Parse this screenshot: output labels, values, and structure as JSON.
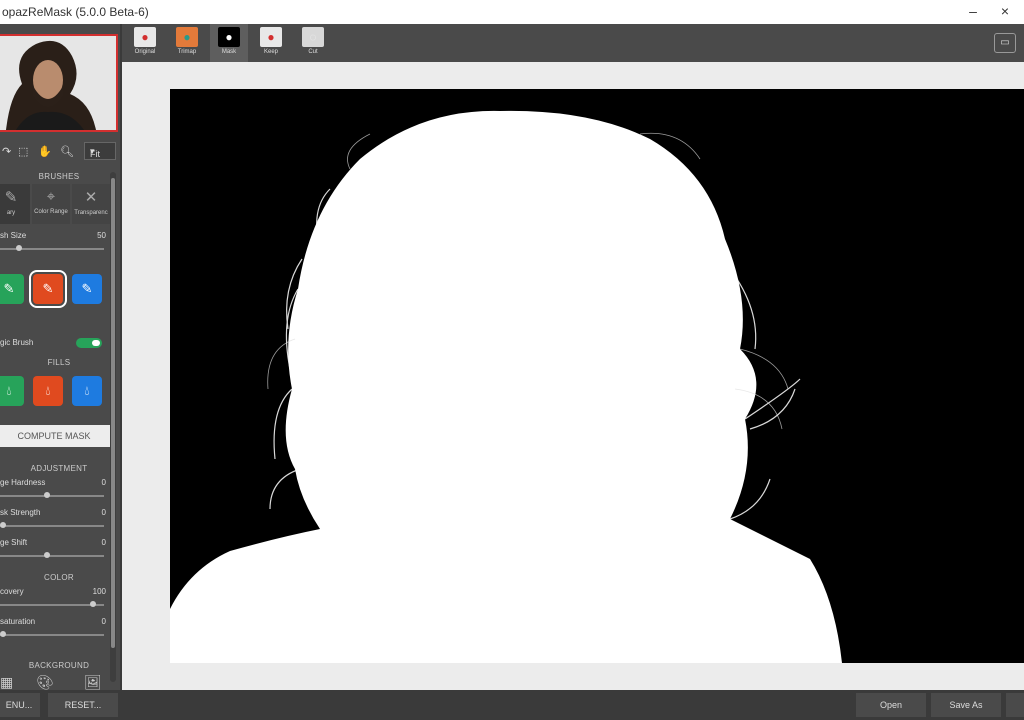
{
  "window": {
    "title": "opazReMask (5.0.0 Beta-6)",
    "minimize": "–",
    "close": "×"
  },
  "toolbar": {
    "zoom_value": "Fit"
  },
  "sections": {
    "brushes": "BRUSHES",
    "fills": "FILLS",
    "adjustment": "ADJUSTMENT",
    "color": "COLOR",
    "background": "BACKGROUND"
  },
  "brushes": [
    {
      "label": "ary"
    },
    {
      "label": "Color Range"
    },
    {
      "label": "Transparenc"
    }
  ],
  "brush_size": {
    "label": "sh Size",
    "value": "50",
    "level": 0.16
  },
  "magic_brush": {
    "label": "gic Brush"
  },
  "compute_mask": "COMPUTE MASK",
  "adjustment": [
    {
      "label": "ge Hardness",
      "value": "0",
      "level": 0.45
    },
    {
      "label": "sk Strength",
      "value": "0",
      "level": 0.0
    },
    {
      "label": "ge Shift",
      "value": "0",
      "level": 0.45
    }
  ],
  "color": [
    {
      "label": "covery",
      "value": "100",
      "level": 0.92
    },
    {
      "label": "saturation",
      "value": "0",
      "level": 0.0
    }
  ],
  "view_tabs": [
    {
      "label": "Original"
    },
    {
      "label": "Trimap"
    },
    {
      "label": "Mask"
    },
    {
      "label": "Keep"
    },
    {
      "label": "Cut"
    }
  ],
  "bottom": {
    "menu": "ENU...",
    "reset": "RESET...",
    "open": "Open",
    "save_as": "Save As"
  }
}
